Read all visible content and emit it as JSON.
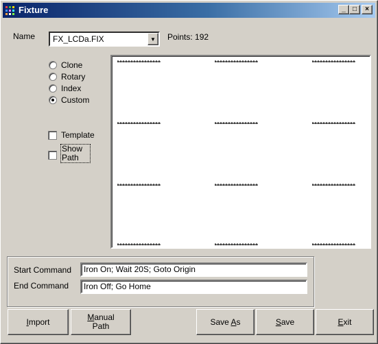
{
  "window": {
    "title": "Fixture",
    "controls": {
      "minimize": "_",
      "maximize": "□",
      "close": "×"
    }
  },
  "name_label": "Name",
  "name_combo": {
    "value": "FX_LCDa.FIX",
    "arrow": "▼"
  },
  "points_label": "Points: 192",
  "mode_options": [
    {
      "label": "Clone",
      "checked": false
    },
    {
      "label": "Rotary",
      "checked": false
    },
    {
      "label": "Index",
      "checked": false
    },
    {
      "label": "Custom",
      "checked": true
    }
  ],
  "template_label": "Template",
  "show_path_label": "Show Path",
  "point_grid": {
    "columns": 3,
    "rows": 4,
    "points_per_group": 16,
    "total_points": 192
  },
  "commands": {
    "start_label": "Start Command",
    "start_value": "Iron On; Wait 20S; Goto Origin",
    "end_label": "End Command",
    "end_value": "Iron Off; Go Home"
  },
  "buttons": {
    "import": {
      "pre": "",
      "key": "I",
      "post": "mport"
    },
    "manual_path": {
      "line1_key": "M",
      "line1_post": "anual",
      "line2": "Path"
    },
    "save_as": {
      "pre": "Save ",
      "key": "A",
      "post": "s"
    },
    "save": {
      "pre": "",
      "key": "S",
      "post": "ave"
    },
    "exit": {
      "pre": "",
      "key": "E",
      "post": "xit"
    }
  }
}
